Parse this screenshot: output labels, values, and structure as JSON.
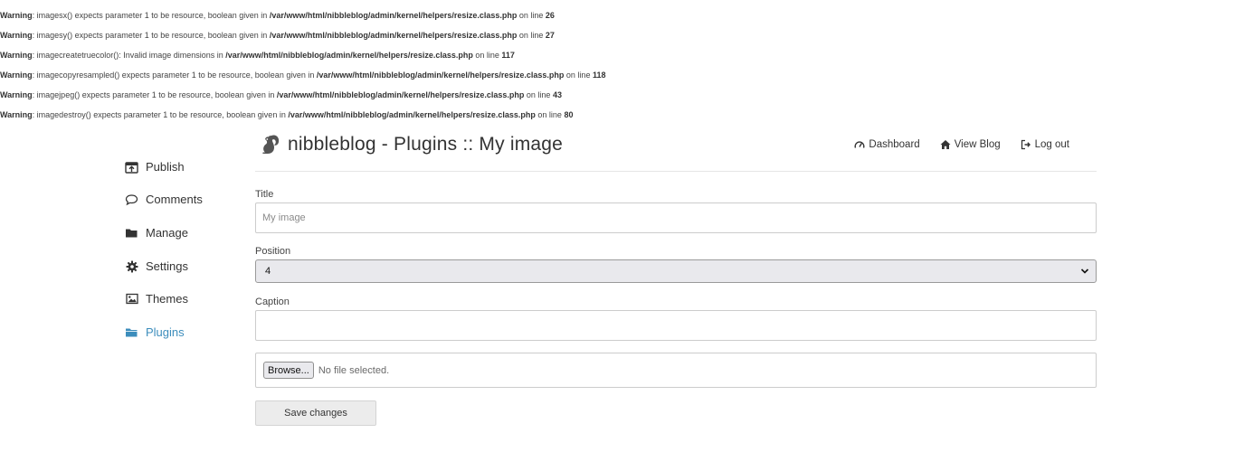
{
  "warnings": [
    {
      "label": "Warning",
      "message": ": imagesx() expects parameter 1 to be resource, boolean given in ",
      "file": "/var/www/html/nibbleblog/admin/kernel/helpers/resize.class.php",
      "on_line": " on line ",
      "line": "26"
    },
    {
      "label": "Warning",
      "message": ": imagesy() expects parameter 1 to be resource, boolean given in ",
      "file": "/var/www/html/nibbleblog/admin/kernel/helpers/resize.class.php",
      "on_line": " on line ",
      "line": "27"
    },
    {
      "label": "Warning",
      "message": ": imagecreatetruecolor(): Invalid image dimensions in ",
      "file": "/var/www/html/nibbleblog/admin/kernel/helpers/resize.class.php",
      "on_line": " on line ",
      "line": "117"
    },
    {
      "label": "Warning",
      "message": ": imagecopyresampled() expects parameter 1 to be resource, boolean given in ",
      "file": "/var/www/html/nibbleblog/admin/kernel/helpers/resize.class.php",
      "on_line": " on line ",
      "line": "118"
    },
    {
      "label": "Warning",
      "message": ": imagejpeg() expects parameter 1 to be resource, boolean given in ",
      "file": "/var/www/html/nibbleblog/admin/kernel/helpers/resize.class.php",
      "on_line": " on line ",
      "line": "43"
    },
    {
      "label": "Warning",
      "message": ": imagedestroy() expects parameter 1 to be resource, boolean given in ",
      "file": "/var/www/html/nibbleblog/admin/kernel/helpers/resize.class.php",
      "on_line": " on line ",
      "line": "80"
    }
  ],
  "header": {
    "title": "nibbleblog - Plugins :: My image",
    "links": {
      "dashboard": "Dashboard",
      "view_blog": "View Blog",
      "log_out": "Log out"
    }
  },
  "sidebar": {
    "items": [
      {
        "label": "Publish",
        "icon": "publish-icon"
      },
      {
        "label": "Comments",
        "icon": "comment-icon"
      },
      {
        "label": "Manage",
        "icon": "folder-icon"
      },
      {
        "label": "Settings",
        "icon": "gear-icon"
      },
      {
        "label": "Themes",
        "icon": "image-icon"
      },
      {
        "label": "Plugins",
        "icon": "folder-open-icon",
        "active": true
      }
    ]
  },
  "form": {
    "title_label": "Title",
    "title_placeholder": "My image",
    "title_value": "",
    "position_label": "Position",
    "position_value": "4",
    "caption_label": "Caption",
    "caption_value": "",
    "browse_label": "Browse...",
    "file_status": "No file selected.",
    "save_label": "Save changes"
  },
  "colors": {
    "accent": "#3c8dbc",
    "text": "#333333",
    "border": "#cccccc"
  }
}
